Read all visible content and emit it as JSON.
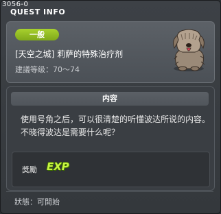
{
  "window": {
    "id_label": "3056-0",
    "title": "QUEST INFO"
  },
  "quest": {
    "category_badge": "一般",
    "name": "[天空之城] 莉萨的特殊治疗剂",
    "recommended_level": "建議等级：70～74",
    "npc_icon": "furry-dog-npc-icon"
  },
  "content": {
    "header": "内容",
    "description": "使用号角之后，可以很清楚的听懂波达所说的内容。不晓得波达是需要什么呢？"
  },
  "reward": {
    "label": "獎勵",
    "exp_label": "EXP"
  },
  "status": {
    "text": "狀態：可開始"
  },
  "colors": {
    "badge_green": "#8fbb22",
    "exp_green": "#c8f542",
    "panel_bg": "#4b5056"
  }
}
